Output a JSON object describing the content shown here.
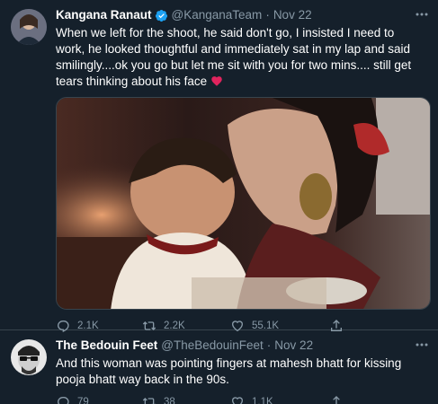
{
  "tweets": [
    {
      "author": "Kangana Ranaut",
      "handle": "@KanganaTeam",
      "separator": "·",
      "time": "Nov 22",
      "text": "When we left for the shoot, he said don't go, I insisted I need to work, he looked thoughtful and immediately sat in my lap and said smilingly....ok you go but let me sit with you for two mins.... still get tears thinking about his face",
      "emoji": "red-heart-icon",
      "replies": "2.1K",
      "retweets": "2.2K",
      "likes": "55.1K"
    },
    {
      "author": "The Bedouin Feet",
      "handle": "@TheBedouinFeet",
      "separator": "·",
      "time": "Nov 22",
      "text": "And this woman was pointing fingers at mahesh bhatt for kissing pooja bhatt way back in the 90s.",
      "replies": "79",
      "retweets": "38",
      "likes": "1.1K"
    }
  ],
  "colors": {
    "background": "#15202b",
    "secondary_text": "#8899a6",
    "verified": "#1da1f2",
    "heart": "#e0245e",
    "divider": "#38444d"
  }
}
